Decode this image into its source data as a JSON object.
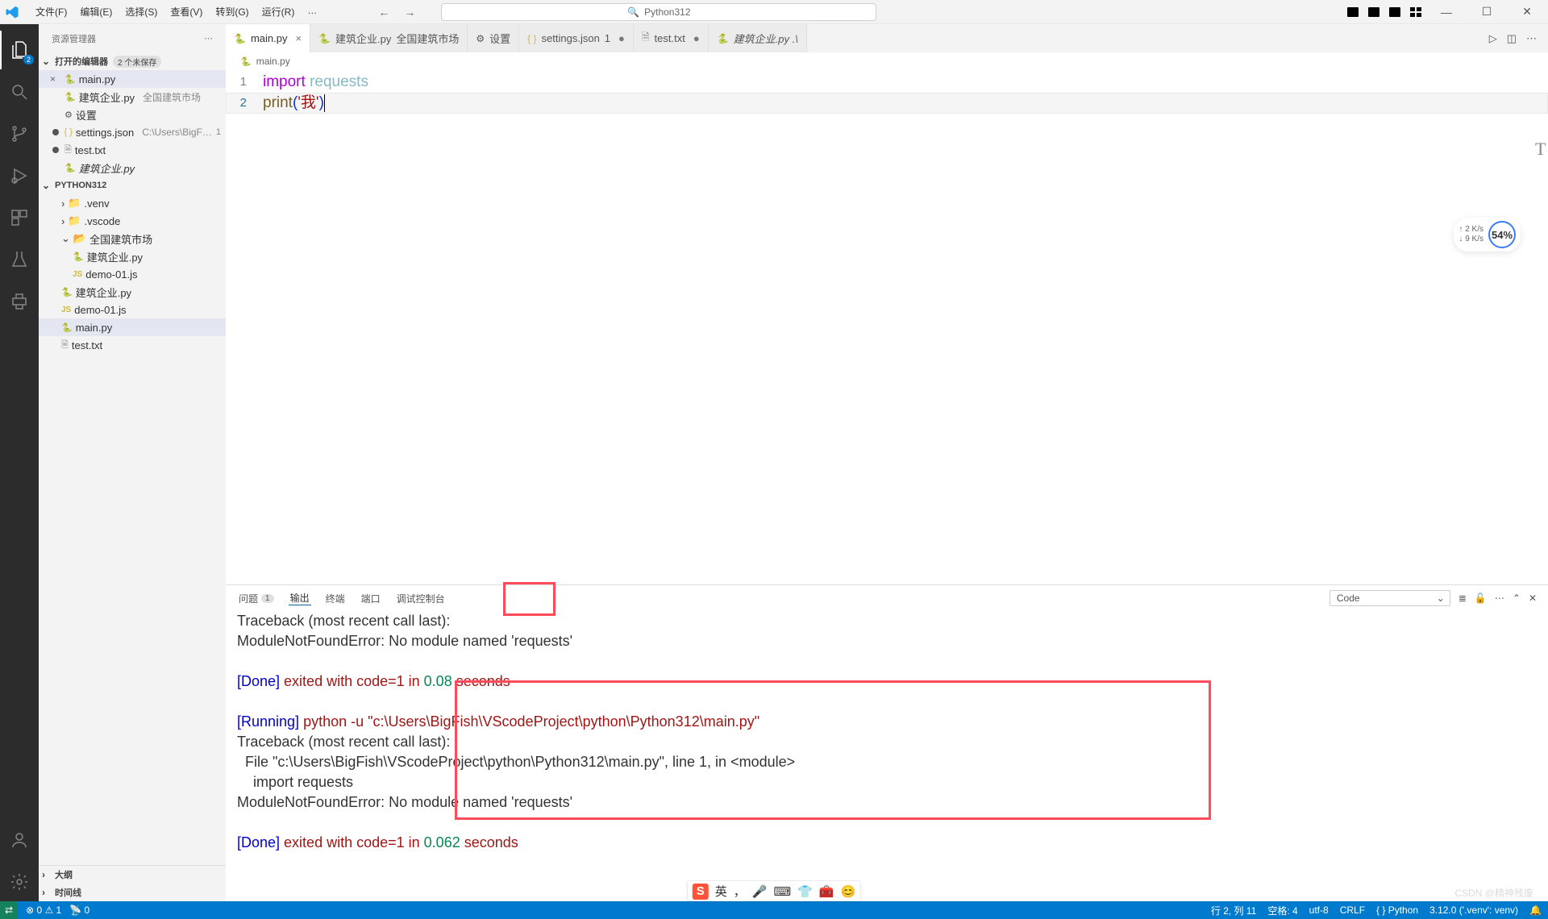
{
  "titlebar": {
    "menus": [
      "文件(F)",
      "编辑(E)",
      "选择(S)",
      "查看(V)",
      "转到(G)",
      "运行(R)",
      "…"
    ],
    "search_label": "Python312"
  },
  "activitybar": {
    "badge": "2"
  },
  "sidebar": {
    "title": "资源管理器",
    "open_editors": {
      "label": "打开的编辑器",
      "badge": "2 个未保存"
    },
    "items": [
      {
        "close": "×",
        "icon": "py",
        "name": "main.py"
      },
      {
        "close": "",
        "icon": "py",
        "name": "建筑企业.py",
        "path": "全国建筑市场"
      },
      {
        "close": "",
        "icon": "gear",
        "name": "设置"
      },
      {
        "close": "●",
        "icon": "json",
        "name": "settings.json",
        "path": "C:\\Users\\BigFis...",
        "count": "1"
      },
      {
        "close": "●",
        "icon": "txt",
        "name": "test.txt"
      },
      {
        "close": "",
        "icon": "py",
        "name": "建筑企业.py",
        "italic": true
      }
    ],
    "project": "PYTHON312",
    "tree": [
      {
        "chev": "›",
        "icon": "folder",
        "name": ".venv",
        "indent": 1
      },
      {
        "chev": "›",
        "icon": "folder",
        "name": ".vscode",
        "indent": 1
      },
      {
        "chev": "⌄",
        "icon": "folder",
        "name": "全国建筑市场",
        "indent": 1
      },
      {
        "icon": "py",
        "name": "建筑企业.py",
        "indent": 2
      },
      {
        "icon": "js",
        "name": "demo-01.js",
        "indent": 2
      },
      {
        "icon": "py",
        "name": "建筑企业.py",
        "indent": 1
      },
      {
        "icon": "js",
        "name": "demo-01.js",
        "indent": 1
      },
      {
        "icon": "py",
        "name": "main.py",
        "indent": 1,
        "active": true
      },
      {
        "icon": "txt",
        "name": "test.txt",
        "indent": 1
      }
    ],
    "outline": "大纲",
    "timeline": "时间线"
  },
  "tabs": [
    {
      "icon": "py",
      "label": "main.py",
      "active": true,
      "close": "×"
    },
    {
      "icon": "py",
      "label": "建筑企业.py",
      "path": "全国建筑市场"
    },
    {
      "icon": "gear",
      "label": "设置"
    },
    {
      "icon": "json",
      "label": "settings.json",
      "count": "1",
      "close": "●"
    },
    {
      "icon": "txt",
      "label": "test.txt",
      "close": "●"
    },
    {
      "icon": "py",
      "label": "建筑企业.py .\\",
      "preview": true
    }
  ],
  "breadcrumb": {
    "icon": "py",
    "name": "main.py"
  },
  "code": {
    "line1": {
      "kw": "import",
      "mod": "requests"
    },
    "line2": {
      "fn": "print",
      "open": "(",
      "str": "'我'",
      "close": ")"
    }
  },
  "netwidget": {
    "up": "↑ 2  K/s",
    "down": "↓ 9  K/s",
    "pct": "54%"
  },
  "panel": {
    "tabs": {
      "problems": "问题",
      "pbadge": "1",
      "output": "输出",
      "terminal": "终端",
      "ports": "端口",
      "debug": "调试控制台"
    },
    "select": "Code",
    "out": {
      "l1": "Traceback (most recent call last):",
      "l2": "ModuleNotFoundError: No module named 'requests'",
      "done1a": "[Done]",
      "done1b": " exited with ",
      "done1c": "code=1",
      "done1d": " in ",
      "done1e": "0.08",
      "done1f": " seconds",
      "run2a": "[Running]",
      "run2b": " python -u \"c:\\Users\\BigFish\\VScodeProject\\python\\Python312\\main.py\"",
      "l3": "Traceback (most recent call last):",
      "l4": "  File \"c:\\Users\\BigFish\\VScodeProject\\python\\Python312\\main.py\", line 1, in <module>",
      "l5": "    import requests",
      "l6": "ModuleNotFoundError: No module named 'requests'",
      "done2a": "[Done]",
      "done2b": " exited with ",
      "done2c": "code=1",
      "done2d": " in ",
      "done2e": "0.062",
      "done2f": " seconds"
    }
  },
  "status": {
    "errors": "⊗ 0 ⚠ 1",
    "ports": "📡 0",
    "ln": "行 2, 列 11",
    "spaces": "空格: 4",
    "enc": "utf-8",
    "eol": "CRLF",
    "lang": "{ } Python",
    "interp": "3.12.0 ('.venv': venv)",
    "bell": "🔔"
  },
  "watermark": "CSDN @精神残废",
  "taskicons": {
    "lang": "英",
    "comma": "，",
    "mic": "🎤"
  }
}
